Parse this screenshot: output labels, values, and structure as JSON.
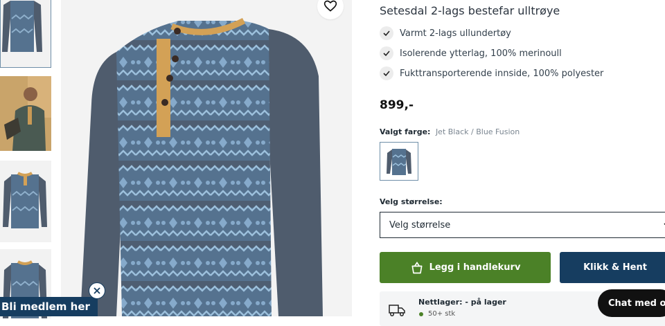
{
  "product": {
    "title": "Setesdal 2-lags bestefar ulltrøye",
    "features": [
      "Varmt 2-lags ullundertøy",
      "Isolerende ytterlag, 100% merinoull",
      "Fukttransporterende innside, 100% polyester"
    ],
    "price": "899,-",
    "color_label": "Valgt farge:",
    "color_value": "Jet Black / Blue Fusion"
  },
  "size": {
    "label": "Velg størrelse:",
    "select_value": "Velg størrelse"
  },
  "actions": {
    "add_to_cart": "Legg i handlekurv",
    "click_collect": "Klikk & Hent"
  },
  "stock": {
    "online": "Nettlager: - på lager",
    "quantity": "50+ stk"
  },
  "member_banner": "Bli medlem her",
  "chat_label": "Chat med oss",
  "colors": {
    "green": "#4b8127",
    "navy": "#163d60",
    "shirt_body": "#55728f",
    "shirt_sleeve": "#4f5c6d",
    "placket": "#d3a156"
  },
  "icons": [
    "heart-icon",
    "check-icon",
    "bag-icon",
    "chevron-down-icon",
    "truck-icon",
    "close-icon",
    "chat-icon"
  ]
}
